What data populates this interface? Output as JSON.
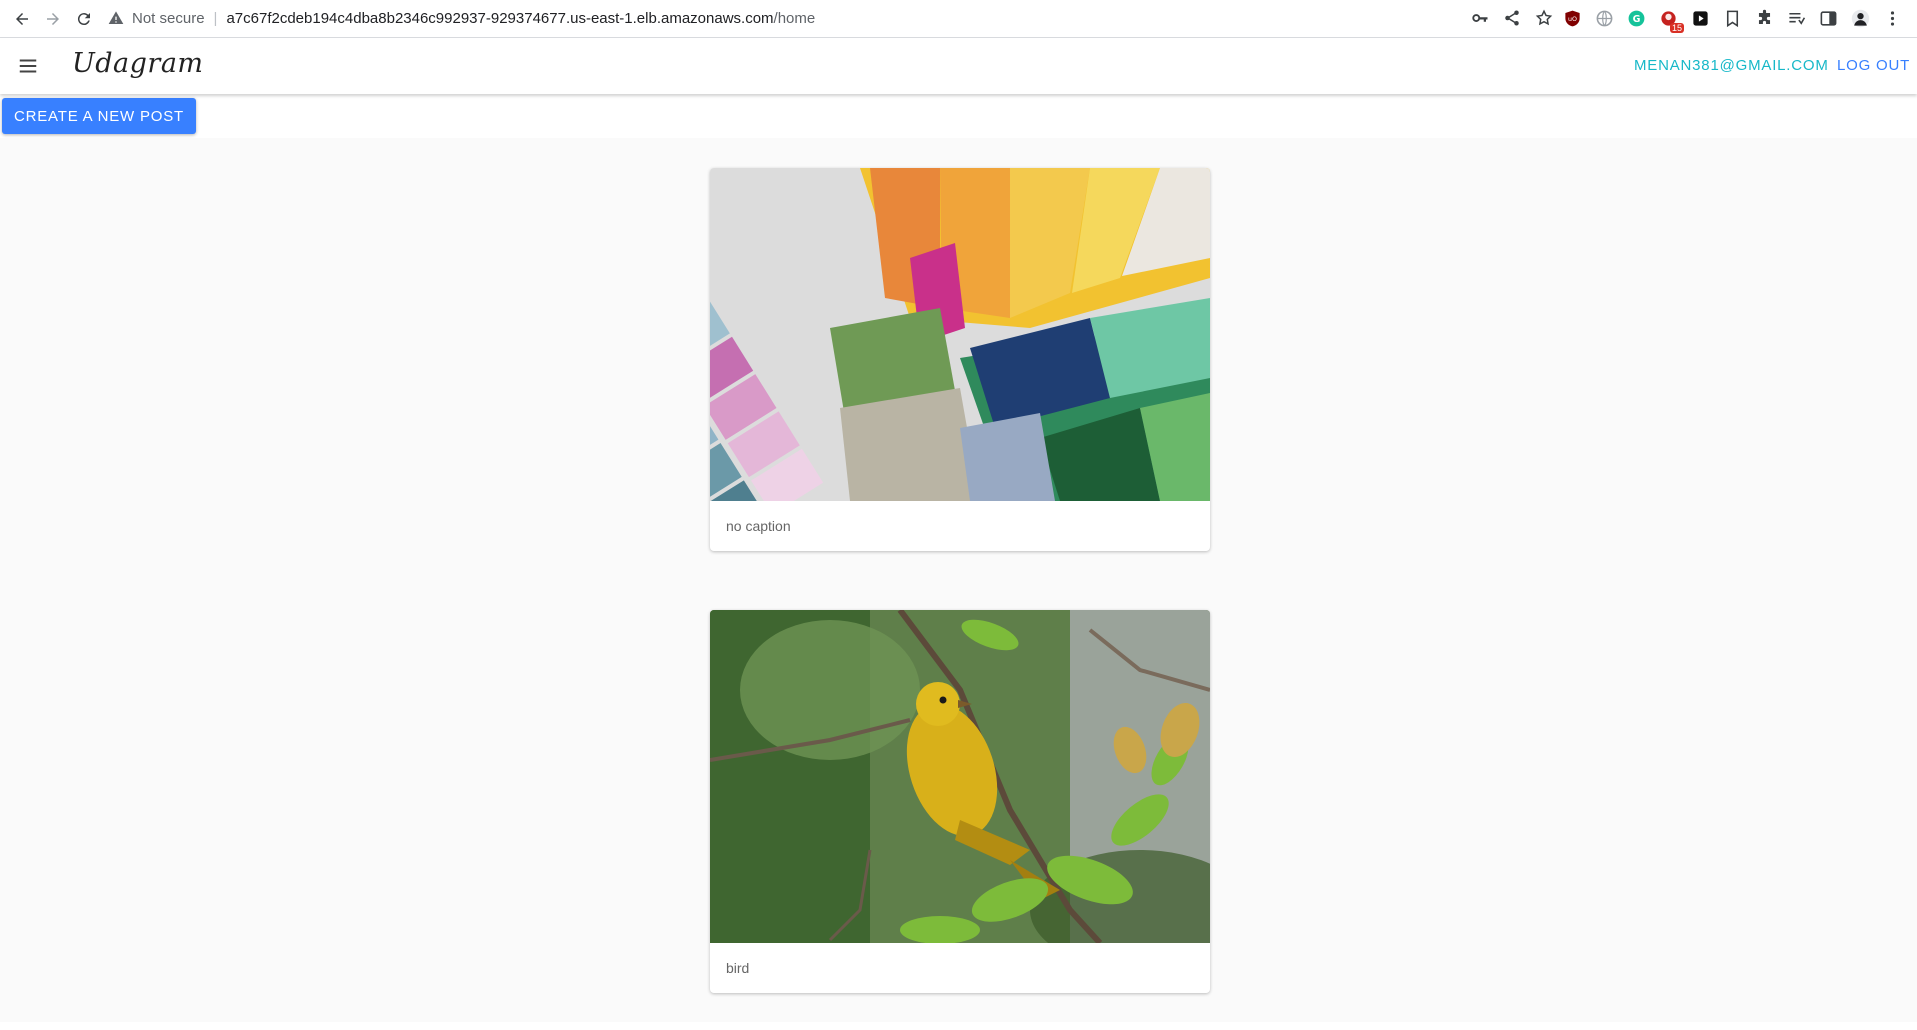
{
  "browser": {
    "security_label": "Not secure",
    "url_host": "a7c67f2cdeb194c4dba8b2346c992937-929374677.us-east-1.elb.amazonaws.com",
    "url_path": "/home",
    "extension_badge": "15"
  },
  "app": {
    "brand": "Udagram",
    "user_email": "menan381@gmail.com",
    "logout_label": "Log out",
    "create_post_label": "Create a new post",
    "colors": {
      "primary": "#3880ff",
      "secondary": "#17b8c8"
    }
  },
  "feed": {
    "posts": [
      {
        "caption": "no caption"
      },
      {
        "caption": "bird"
      }
    ]
  }
}
